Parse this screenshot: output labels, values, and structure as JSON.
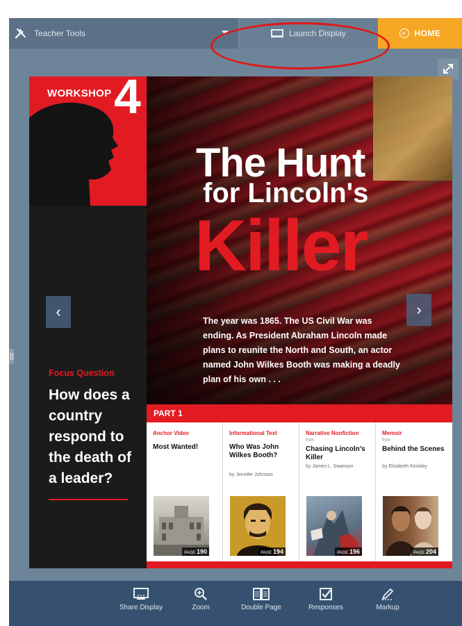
{
  "topbar": {
    "teacher_tools": "Teacher Tools",
    "launch_display": "Launch Display",
    "home": "HOME"
  },
  "workshop": {
    "label": "WORKSHOP",
    "number": "4",
    "title_line1": "The Hunt",
    "title_line2": "for Lincoln's",
    "title_line3": "Killer",
    "intro": "The year was 1865. The US Civil War was ending. As President Abraham Lincoln made plans to reunite the North and South, an actor named John Wilkes Booth was making a deadly plan of his own . . ."
  },
  "focus": {
    "label": "Focus Question",
    "question": "How does a country respond to the death of a leader?"
  },
  "part": {
    "label": "PART 1",
    "cards": [
      {
        "category": "Anchor Video",
        "from": "",
        "title": "Most Wanted!",
        "author": "",
        "page_label": "PAGE",
        "page": "190"
      },
      {
        "category": "Informational Text",
        "from": "",
        "title": "Who Was John Wilkes Booth?",
        "author": "by Jennifer Johnson",
        "page_label": "PAGE",
        "page": "194"
      },
      {
        "category": "Narrative Nonfiction",
        "from": "from",
        "title": "Chasing Lincoln's Killer",
        "author": "by James L. Swanson",
        "page_label": "PAGE",
        "page": "196"
      },
      {
        "category": "Memoir",
        "from": "from",
        "title": "Behind the Scenes",
        "author": "by Elizabeth Keckley",
        "page_label": "PAGE",
        "page": "204"
      }
    ]
  },
  "toolbar": {
    "share_display": "Share Display",
    "zoom": "Zoom",
    "double_page": "Double Page",
    "responses": "Responses",
    "markup": "Markup"
  },
  "colors": {
    "accent_red": "#e21b23",
    "home_orange": "#f5a623",
    "toolbar_blue": "#36516f",
    "annotation_red": "#e01818"
  },
  "icons": [
    "tools-icon",
    "dropdown-arrow-icon",
    "screen-icon",
    "back-circle-icon",
    "expand-icon",
    "share-display-icon",
    "zoom-icon",
    "double-page-icon",
    "responses-icon",
    "markup-icon",
    "chevron-left-icon",
    "chevron-right-icon"
  ]
}
